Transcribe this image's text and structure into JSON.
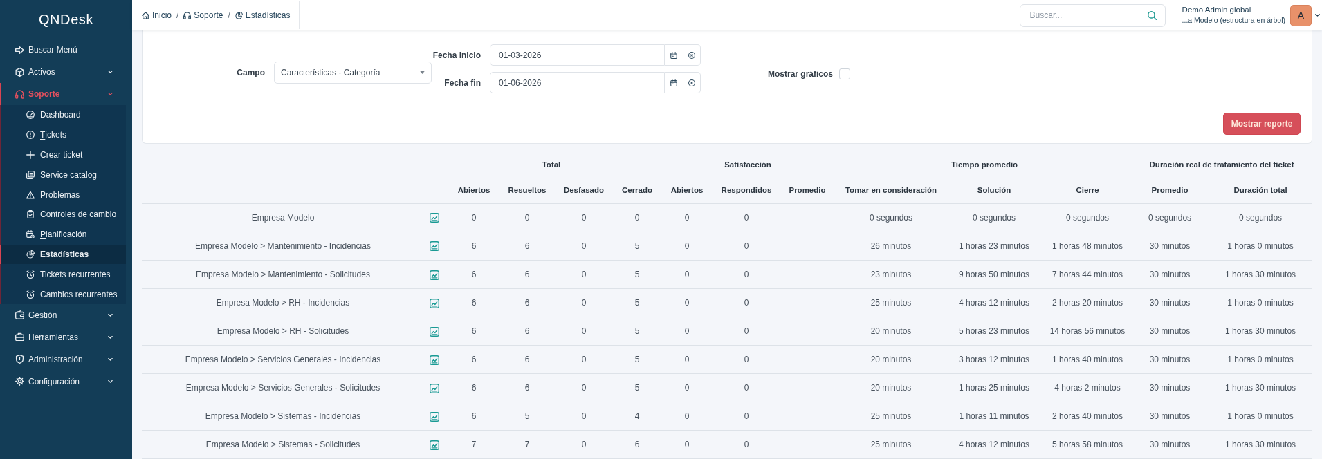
{
  "sidebar": {
    "logo": "QNDesk",
    "items": [
      {
        "kind": "link",
        "label": "Buscar Menú",
        "selected": false
      },
      {
        "kind": "menu",
        "label": "Activos",
        "selected": false
      },
      {
        "kind": "menu",
        "label": "Soporte",
        "selected": true,
        "expanded": true,
        "children": [
          {
            "label": "Dashboard",
            "selected": false
          },
          {
            "label": [
              {
                "text": "T",
                "underlined": true
              },
              {
                "text": "ickets",
                "underlined": false
              }
            ],
            "selected": false
          },
          {
            "label": "Crear ticket",
            "selected": false
          },
          {
            "label": "Service catalog",
            "selected": false
          },
          {
            "label": "Problemas",
            "selected": false
          },
          {
            "label": "Controles de cambio",
            "selected": false
          },
          {
            "label": [
              {
                "text": "P",
                "underlined": true
              },
              {
                "text": "lanificación",
                "underlined": false
              }
            ],
            "selected": false
          },
          {
            "label": [
              {
                "text": "Est",
                "underlined": false
              },
              {
                "text": "a",
                "underlined": true
              },
              {
                "text": "dísticas",
                "underlined": false
              }
            ],
            "selected": true
          },
          {
            "label": [
              {
                "text": "Tickets recurre",
                "underlined": false
              },
              {
                "text": "n",
                "underlined": true
              },
              {
                "text": "tes",
                "underlined": false
              }
            ],
            "selected": false
          },
          {
            "label": [
              {
                "text": "Cambios recurre",
                "underlined": false
              },
              {
                "text": "n",
                "underlined": true
              },
              {
                "text": "tes",
                "underlined": false
              }
            ],
            "selected": false
          }
        ]
      },
      {
        "kind": "menu",
        "label": "Gestión",
        "selected": false
      },
      {
        "kind": "menu",
        "label": "Herramientas",
        "selected": false
      },
      {
        "kind": "menu",
        "label": "Administración",
        "selected": false
      },
      {
        "kind": "menu",
        "label": "Configuración",
        "selected": false
      }
    ]
  },
  "topbar": {
    "breadcrumb": [
      {
        "kind": "crumb",
        "label": "Inicio"
      },
      {
        "kind": "divider",
        "label": "/"
      },
      {
        "kind": "crumb",
        "label": "Soporte"
      },
      {
        "kind": "divider",
        "label": "/"
      },
      {
        "kind": "crumb",
        "label": "Estadísticas"
      }
    ],
    "search": {
      "placeholder": "Buscar..."
    },
    "user": {
      "name": "Demo Admin global",
      "entity": "...a Modelo (estructura en árbol)",
      "initial": "A"
    }
  },
  "filters": {
    "campo": {
      "label": "Campo",
      "value": "Características - Categoría"
    },
    "dates": [
      {
        "label": "Fecha inicio",
        "value": "01-03-2026"
      },
      {
        "label": "Fecha fin",
        "value": "01-06-2026"
      }
    ],
    "show_charts": {
      "label": "Mostrar gráficos",
      "checked": false
    },
    "submit": "Mostrar reporte"
  },
  "table": {
    "column_groups": [
      {
        "label": "Total",
        "columns": [
          "Abiertos",
          "Resueltos",
          "Desfasado",
          "Cerrado"
        ]
      },
      {
        "label": "Satisfacción",
        "columns": [
          "Abiertos",
          "Respondidos",
          "Promedio"
        ]
      },
      {
        "label": "Tiempo promedio",
        "columns": [
          "Tomar en consideración",
          "Solución",
          "Cierre"
        ]
      },
      {
        "label": "Duración real de tratamiento del ticket",
        "columns": [
          "Promedio",
          "Duración total"
        ]
      }
    ],
    "rows": [
      {
        "name": "Empresa Modelo",
        "cells": [
          "0",
          "0",
          "0",
          "0",
          "0",
          "0",
          null,
          "0 segundos",
          "0 segundos",
          "0 segundos",
          "0 segundos",
          "0 segundos"
        ]
      },
      {
        "name": "Empresa Modelo > Mantenimiento - Incidencias",
        "cells": [
          "6",
          "6",
          "0",
          "5",
          "0",
          "0",
          null,
          "26 minutos",
          "1 horas 23 minutos",
          "1 horas 48 minutos",
          "30 minutos",
          "1 horas 0 minutos"
        ]
      },
      {
        "name": "Empresa Modelo > Mantenimiento - Solicitudes",
        "cells": [
          "6",
          "6",
          "0",
          "5",
          "0",
          "0",
          null,
          "23 minutos",
          "9 horas 50 minutos",
          "7 horas 44 minutos",
          "30 minutos",
          "1 horas 30 minutos"
        ]
      },
      {
        "name": "Empresa Modelo > RH - Incidencias",
        "cells": [
          "6",
          "6",
          "0",
          "5",
          "0",
          "0",
          null,
          "25 minutos",
          "4 horas 12 minutos",
          "2 horas 20 minutos",
          "30 minutos",
          "1 horas 0 minutos"
        ]
      },
      {
        "name": "Empresa Modelo > RH - Solicitudes",
        "cells": [
          "6",
          "6",
          "0",
          "5",
          "0",
          "0",
          null,
          "20 minutos",
          "5 horas 23 minutos",
          "14 horas 56 minutos",
          "30 minutos",
          "1 horas 30 minutos"
        ]
      },
      {
        "name": "Empresa Modelo > Servicios Generales - Incidencias",
        "cells": [
          "6",
          "6",
          "0",
          "5",
          "0",
          "0",
          null,
          "20 minutos",
          "3 horas 12 minutos",
          "1 horas 40 minutos",
          "30 minutos",
          "1 horas 0 minutos"
        ]
      },
      {
        "name": "Empresa Modelo > Servicios Generales - Solicitudes",
        "cells": [
          "6",
          "6",
          "0",
          "5",
          "0",
          "0",
          null,
          "20 minutos",
          "1 horas 25 minutos",
          "4 horas 2 minutos",
          "30 minutos",
          "1 horas 30 minutos"
        ]
      },
      {
        "name": "Empresa Modelo > Sistemas - Incidencias",
        "cells": [
          "6",
          "5",
          "0",
          "4",
          "0",
          "0",
          null,
          "25 minutos",
          "1 horas 11 minutos",
          "2 horas 40 minutos",
          "30 minutos",
          "1 horas 0 minutos"
        ]
      },
      {
        "name": "Empresa Modelo > Sistemas - Solicitudes",
        "cells": [
          "7",
          "7",
          "0",
          "6",
          "0",
          "0",
          null,
          "25 minutos",
          "4 horas 12 minutos",
          "5 horas 58 minutos",
          "30 minutos",
          "1 horas 30 minutos"
        ]
      }
    ]
  }
}
